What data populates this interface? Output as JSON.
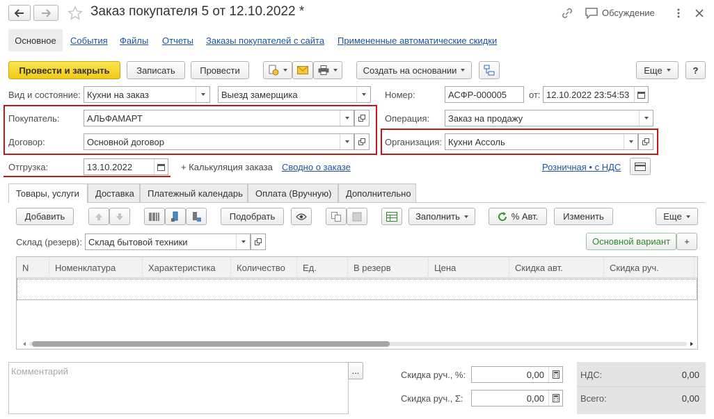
{
  "window": {
    "title": "Заказ покупателя 5 от 12.10.2022 *",
    "discussion": "Обсуждение"
  },
  "nav_tabs": [
    "Основное",
    "События",
    "Файлы",
    "Отчеты",
    "Заказы покупателей с сайта",
    "Примененные автоматические скидки"
  ],
  "toolbar": {
    "post_close": "Провести и закрыть",
    "save": "Записать",
    "post": "Провести",
    "create_based": "Создать на основании",
    "more": "Еще",
    "help": "?"
  },
  "header": {
    "type_state_label": "Вид и состояние:",
    "type_value": "Кухни на заказ",
    "state_value": "Выезд замерщика",
    "number_label": "Номер:",
    "number_value": "АСФР-000005",
    "date_from_label": "от:",
    "date_value": "12.10.2022 23:54:53",
    "buyer_label": "Покупатель:",
    "buyer_value": "АЛЬФАМАРТ",
    "operation_label": "Операция:",
    "operation_value": "Заказ на продажу",
    "contract_label": "Договор:",
    "contract_value": "Основной договор",
    "org_label": "Организация:",
    "org_value": "Кухни Ассоль",
    "shipment_label": "Отгрузка:",
    "shipment_value": "13.10.2022",
    "calc_label": "+ Калькуляция заказа",
    "summary_link": "Сводно о заказе",
    "retail_link": "Розничная • с НДС"
  },
  "doc_tabs": [
    "Товары, услуги",
    "Доставка",
    "Платежный календарь",
    "Оплата (Вручную)",
    "Дополнительно"
  ],
  "table_toolbar": {
    "add": "Добавить",
    "pick": "Подобрать",
    "fill": "Заполнить",
    "auto_pct": "% Авт.",
    "change": "Изменить",
    "more": "Еще"
  },
  "warehouse": {
    "label": "Склад (резерв):",
    "value": "Склад бытовой техники",
    "variant": "Основной вариант",
    "plus": "+"
  },
  "table": {
    "columns": [
      "N",
      "Номенклатура",
      "Характеристика",
      "Количество",
      "Ед.",
      "В резерв",
      "Цена",
      "Скидка авт.",
      "Скидка руч."
    ]
  },
  "footer": {
    "comment_placeholder": "Комментарий",
    "ellipsis": "...",
    "disc_pct_label": "Скидка руч., %:",
    "disc_pct_value": "0,00",
    "disc_sum_label": "Скидка руч., Σ:",
    "disc_sum_value": "0,00",
    "vat_label": "НДС:",
    "vat_value": "0,00",
    "total_label": "Всего:",
    "total_value": "0,00"
  }
}
